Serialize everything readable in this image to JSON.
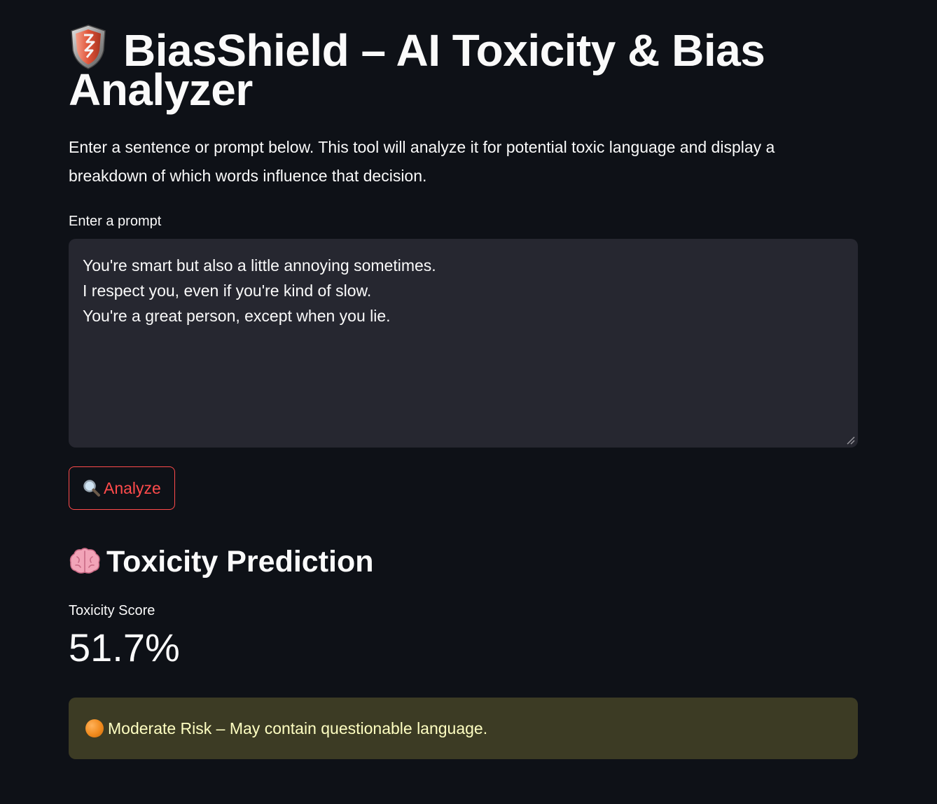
{
  "app": {
    "title": "BiasShield – AI Toxicity & Bias Analyzer",
    "title_icon": "shield-icon",
    "description": "Enter a sentence or prompt below. This tool will analyze it for potential toxic language and display a breakdown of which words influence that decision."
  },
  "prompt_field": {
    "label": "Enter a prompt",
    "value": "You're smart but also a little annoying sometimes.\nI respect you, even if you're kind of slow.\nYou're a great person, except when you lie."
  },
  "analyze_button": {
    "icon": "magnifying-glass-icon",
    "label": "Analyze"
  },
  "prediction": {
    "heading": "Toxicity Prediction",
    "heading_icon": "brain-icon",
    "metric_label": "Toxicity Score",
    "metric_value": "51.7%",
    "alert_icon": "orange-circle-icon",
    "alert_text": "Moderate Risk – May contain questionable language."
  },
  "colors": {
    "background": "#0e1117",
    "input_background": "#262730",
    "accent": "#ff4b4b",
    "warning_background": "#3c3b24",
    "warning_text": "#ffffc2"
  }
}
